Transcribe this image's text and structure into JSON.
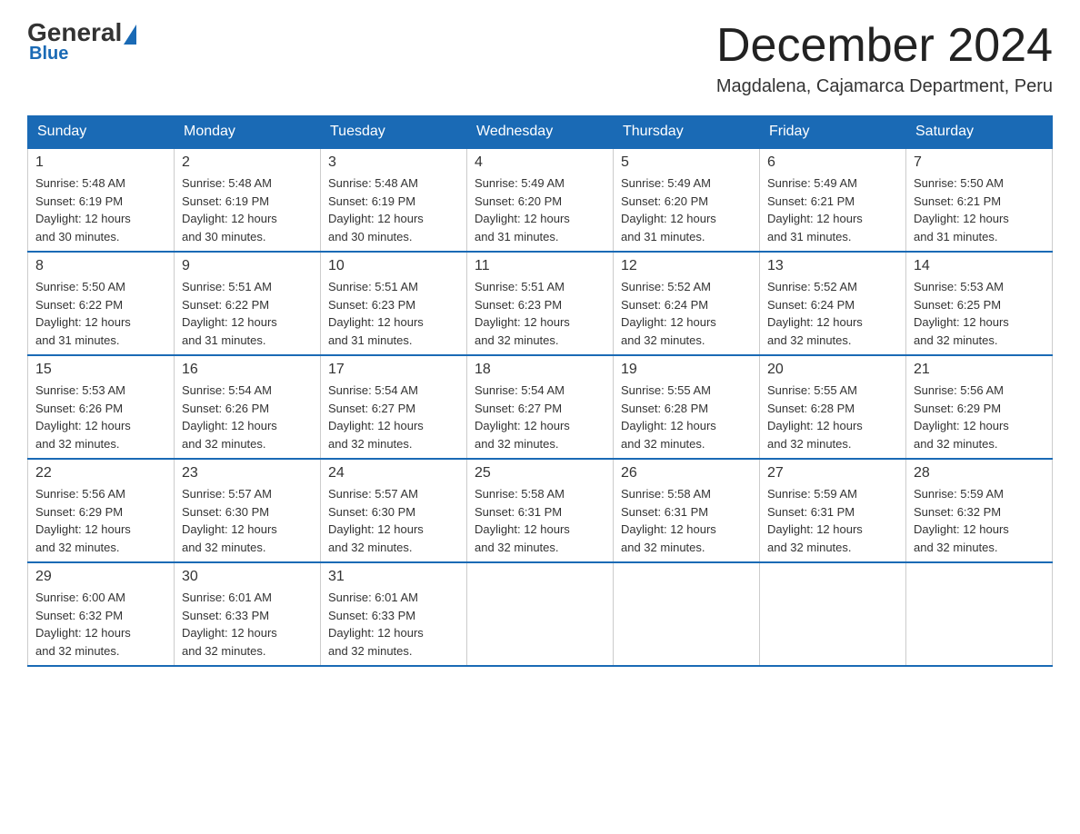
{
  "header": {
    "logo_general": "General",
    "logo_blue": "Blue",
    "month_title": "December 2024",
    "location": "Magdalena, Cajamarca Department, Peru"
  },
  "weekdays": [
    "Sunday",
    "Monday",
    "Tuesday",
    "Wednesday",
    "Thursday",
    "Friday",
    "Saturday"
  ],
  "weeks": [
    [
      {
        "day": "1",
        "sunrise": "5:48 AM",
        "sunset": "6:19 PM",
        "daylight": "12 hours and 30 minutes."
      },
      {
        "day": "2",
        "sunrise": "5:48 AM",
        "sunset": "6:19 PM",
        "daylight": "12 hours and 30 minutes."
      },
      {
        "day": "3",
        "sunrise": "5:48 AM",
        "sunset": "6:19 PM",
        "daylight": "12 hours and 30 minutes."
      },
      {
        "day": "4",
        "sunrise": "5:49 AM",
        "sunset": "6:20 PM",
        "daylight": "12 hours and 31 minutes."
      },
      {
        "day": "5",
        "sunrise": "5:49 AM",
        "sunset": "6:20 PM",
        "daylight": "12 hours and 31 minutes."
      },
      {
        "day": "6",
        "sunrise": "5:49 AM",
        "sunset": "6:21 PM",
        "daylight": "12 hours and 31 minutes."
      },
      {
        "day": "7",
        "sunrise": "5:50 AM",
        "sunset": "6:21 PM",
        "daylight": "12 hours and 31 minutes."
      }
    ],
    [
      {
        "day": "8",
        "sunrise": "5:50 AM",
        "sunset": "6:22 PM",
        "daylight": "12 hours and 31 minutes."
      },
      {
        "day": "9",
        "sunrise": "5:51 AM",
        "sunset": "6:22 PM",
        "daylight": "12 hours and 31 minutes."
      },
      {
        "day": "10",
        "sunrise": "5:51 AM",
        "sunset": "6:23 PM",
        "daylight": "12 hours and 31 minutes."
      },
      {
        "day": "11",
        "sunrise": "5:51 AM",
        "sunset": "6:23 PM",
        "daylight": "12 hours and 32 minutes."
      },
      {
        "day": "12",
        "sunrise": "5:52 AM",
        "sunset": "6:24 PM",
        "daylight": "12 hours and 32 minutes."
      },
      {
        "day": "13",
        "sunrise": "5:52 AM",
        "sunset": "6:24 PM",
        "daylight": "12 hours and 32 minutes."
      },
      {
        "day": "14",
        "sunrise": "5:53 AM",
        "sunset": "6:25 PM",
        "daylight": "12 hours and 32 minutes."
      }
    ],
    [
      {
        "day": "15",
        "sunrise": "5:53 AM",
        "sunset": "6:26 PM",
        "daylight": "12 hours and 32 minutes."
      },
      {
        "day": "16",
        "sunrise": "5:54 AM",
        "sunset": "6:26 PM",
        "daylight": "12 hours and 32 minutes."
      },
      {
        "day": "17",
        "sunrise": "5:54 AM",
        "sunset": "6:27 PM",
        "daylight": "12 hours and 32 minutes."
      },
      {
        "day": "18",
        "sunrise": "5:54 AM",
        "sunset": "6:27 PM",
        "daylight": "12 hours and 32 minutes."
      },
      {
        "day": "19",
        "sunrise": "5:55 AM",
        "sunset": "6:28 PM",
        "daylight": "12 hours and 32 minutes."
      },
      {
        "day": "20",
        "sunrise": "5:55 AM",
        "sunset": "6:28 PM",
        "daylight": "12 hours and 32 minutes."
      },
      {
        "day": "21",
        "sunrise": "5:56 AM",
        "sunset": "6:29 PM",
        "daylight": "12 hours and 32 minutes."
      }
    ],
    [
      {
        "day": "22",
        "sunrise": "5:56 AM",
        "sunset": "6:29 PM",
        "daylight": "12 hours and 32 minutes."
      },
      {
        "day": "23",
        "sunrise": "5:57 AM",
        "sunset": "6:30 PM",
        "daylight": "12 hours and 32 minutes."
      },
      {
        "day": "24",
        "sunrise": "5:57 AM",
        "sunset": "6:30 PM",
        "daylight": "12 hours and 32 minutes."
      },
      {
        "day": "25",
        "sunrise": "5:58 AM",
        "sunset": "6:31 PM",
        "daylight": "12 hours and 32 minutes."
      },
      {
        "day": "26",
        "sunrise": "5:58 AM",
        "sunset": "6:31 PM",
        "daylight": "12 hours and 32 minutes."
      },
      {
        "day": "27",
        "sunrise": "5:59 AM",
        "sunset": "6:31 PM",
        "daylight": "12 hours and 32 minutes."
      },
      {
        "day": "28",
        "sunrise": "5:59 AM",
        "sunset": "6:32 PM",
        "daylight": "12 hours and 32 minutes."
      }
    ],
    [
      {
        "day": "29",
        "sunrise": "6:00 AM",
        "sunset": "6:32 PM",
        "daylight": "12 hours and 32 minutes."
      },
      {
        "day": "30",
        "sunrise": "6:01 AM",
        "sunset": "6:33 PM",
        "daylight": "12 hours and 32 minutes."
      },
      {
        "day": "31",
        "sunrise": "6:01 AM",
        "sunset": "6:33 PM",
        "daylight": "12 hours and 32 minutes."
      },
      null,
      null,
      null,
      null
    ]
  ],
  "labels": {
    "sunrise_prefix": "Sunrise: ",
    "sunset_prefix": "Sunset: ",
    "daylight_prefix": "Daylight: "
  }
}
